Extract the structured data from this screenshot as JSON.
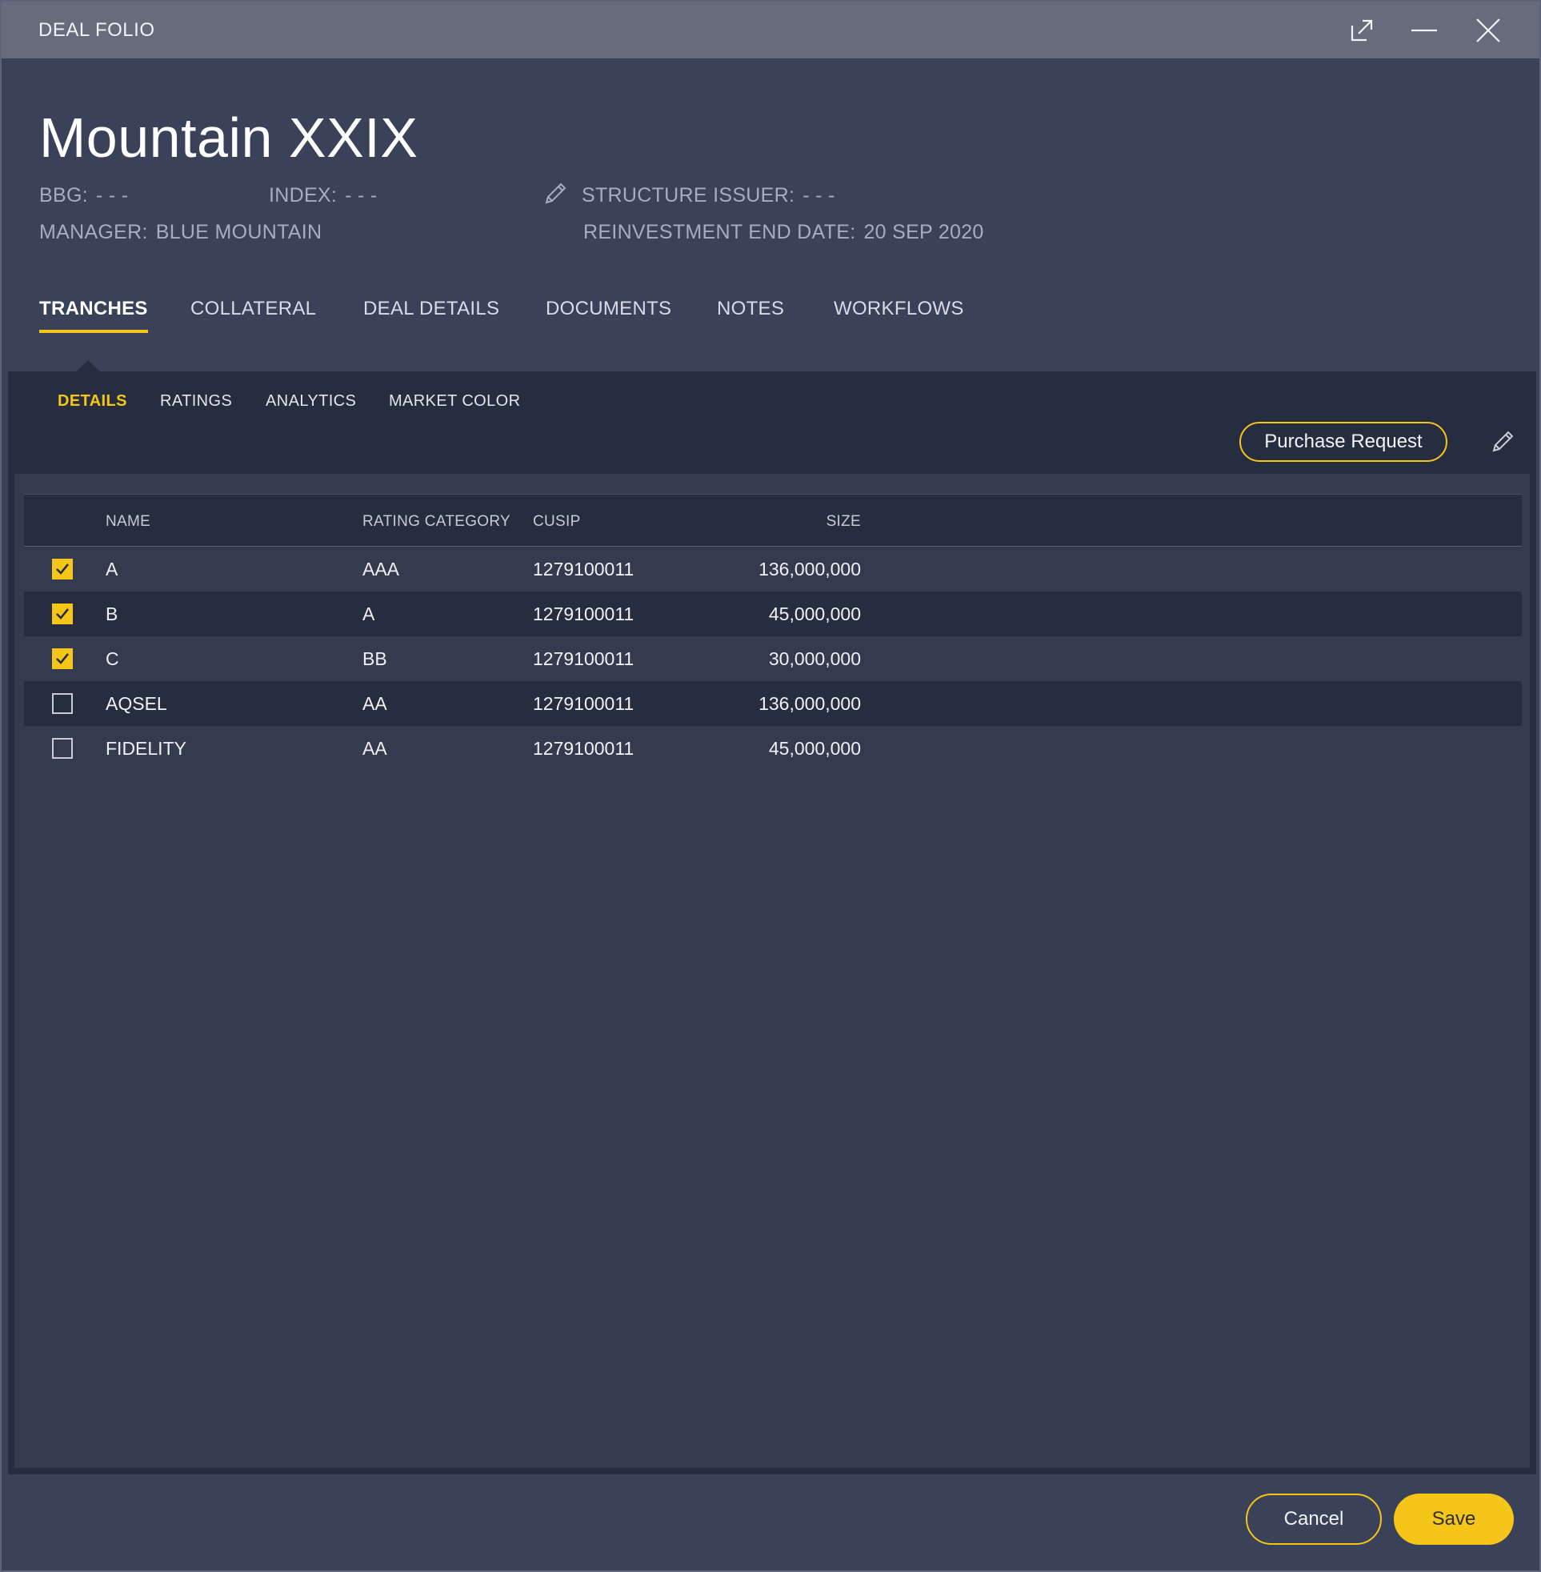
{
  "window": {
    "title": "DEAL FOLIO",
    "controls": [
      "popout-icon",
      "minimize-icon",
      "close-icon"
    ]
  },
  "header": {
    "deal_name": "Mountain XXIX",
    "bbg_label": "BBG:",
    "bbg_value": "- - -",
    "index_label": "INDEX:",
    "index_value": "- - -",
    "structure_issuer_label": "STRUCTURE ISSUER:",
    "structure_issuer_value": "- - -",
    "manager_label": "MANAGER:",
    "manager_value": "BLUE MOUNTAIN",
    "reinvestment_label": "REINVESTMENT END DATE:",
    "reinvestment_value": "20 SEP 2020"
  },
  "main_tabs": [
    {
      "label": "TRANCHES",
      "active": true
    },
    {
      "label": "COLLATERAL",
      "active": false
    },
    {
      "label": "DEAL DETAILS",
      "active": false
    },
    {
      "label": "DOCUMENTS",
      "active": false
    },
    {
      "label": "NOTES",
      "active": false
    },
    {
      "label": "WORKFLOWS",
      "active": false
    }
  ],
  "sub_tabs": [
    {
      "label": "DETAILS",
      "active": true
    },
    {
      "label": "RATINGS",
      "active": false
    },
    {
      "label": "ANALYTICS",
      "active": false
    },
    {
      "label": "MARKET COLOR",
      "active": false
    }
  ],
  "actions": {
    "purchase_request": "Purchase Request"
  },
  "table": {
    "columns": [
      "NAME",
      "RATING CATEGORY",
      "CUSIP",
      "SIZE"
    ],
    "rows": [
      {
        "checked": true,
        "name": "A",
        "rating": "AAA",
        "cusip": "1279100011",
        "size": "136,000,000"
      },
      {
        "checked": true,
        "name": "B",
        "rating": "A",
        "cusip": "1279100011",
        "size": "45,000,000"
      },
      {
        "checked": true,
        "name": "C",
        "rating": "BB",
        "cusip": "1279100011",
        "size": "30,000,000"
      },
      {
        "checked": false,
        "name": "AQSEL",
        "rating": "AA",
        "cusip": "1279100011",
        "size": "136,000,000"
      },
      {
        "checked": false,
        "name": "FIDELITY",
        "rating": "AA",
        "cusip": "1279100011",
        "size": "45,000,000"
      }
    ]
  },
  "footer": {
    "cancel_label": "Cancel",
    "save_label": "Save"
  },
  "colors": {
    "accent": "#f5c518",
    "title_bar": "#666c7c",
    "window_bg": "#3a4259",
    "panel_bg": "#262d3f",
    "table_bg": "#353b4e"
  }
}
